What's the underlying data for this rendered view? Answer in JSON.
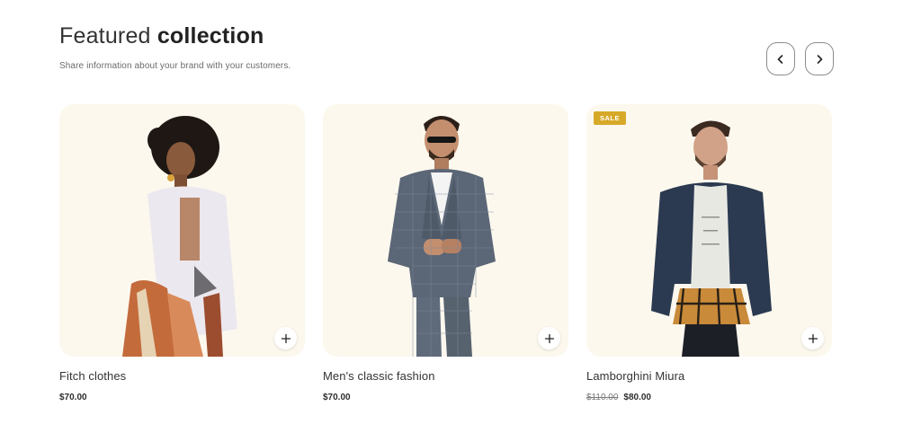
{
  "section": {
    "title_regular": "Featured",
    "title_bold": "collection",
    "subtitle": "Share information about your brand with your customers."
  },
  "nav": {
    "prev_icon": "chevron-left-icon",
    "next_icon": "chevron-right-icon"
  },
  "products": [
    {
      "name": "Fitch clothes",
      "price": "$70.00",
      "old_price": "",
      "badge": ""
    },
    {
      "name": "Men's classic fashion",
      "price": "$70.00",
      "old_price": "",
      "badge": ""
    },
    {
      "name": "Lamborghini Miura",
      "price": "$80.00",
      "old_price": "$110.00",
      "badge": "SALE"
    }
  ],
  "colors": {
    "card_background": "#fcf8ee",
    "sale_badge": "#d7a928",
    "text_dark": "#2b2b2b"
  }
}
